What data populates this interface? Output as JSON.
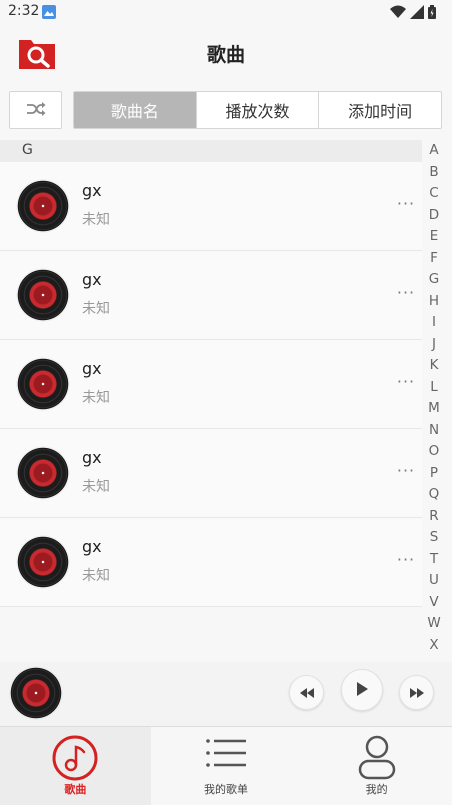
{
  "status_bar": {
    "time": "2:32"
  },
  "header": {
    "title": "歌曲"
  },
  "sort_tabs": [
    {
      "label": "歌曲名",
      "active": true
    },
    {
      "label": "播放次数",
      "active": false
    },
    {
      "label": "添加时间",
      "active": false
    }
  ],
  "section": {
    "letter": "G"
  },
  "songs": [
    {
      "title": "gx",
      "artist": "未知"
    },
    {
      "title": "gx",
      "artist": "未知"
    },
    {
      "title": "gx",
      "artist": "未知"
    },
    {
      "title": "gx",
      "artist": "未知"
    },
    {
      "title": "gx",
      "artist": "未知"
    }
  ],
  "more_label": "···",
  "alphabet": [
    "A",
    "B",
    "C",
    "D",
    "E",
    "F",
    "G",
    "H",
    "I",
    "J",
    "K",
    "L",
    "M",
    "N",
    "O",
    "P",
    "Q",
    "R",
    "S",
    "T",
    "U",
    "V",
    "W",
    "X"
  ],
  "bottom_nav": [
    {
      "label": "歌曲",
      "icon": "music-note-icon",
      "active": true
    },
    {
      "label": "我的歌单",
      "icon": "playlist-icon",
      "active": false
    },
    {
      "label": "我的",
      "icon": "person-icon",
      "active": false
    }
  ],
  "colors": {
    "accent": "#d22222",
    "active_tab_bg": "#b6b6b6"
  }
}
